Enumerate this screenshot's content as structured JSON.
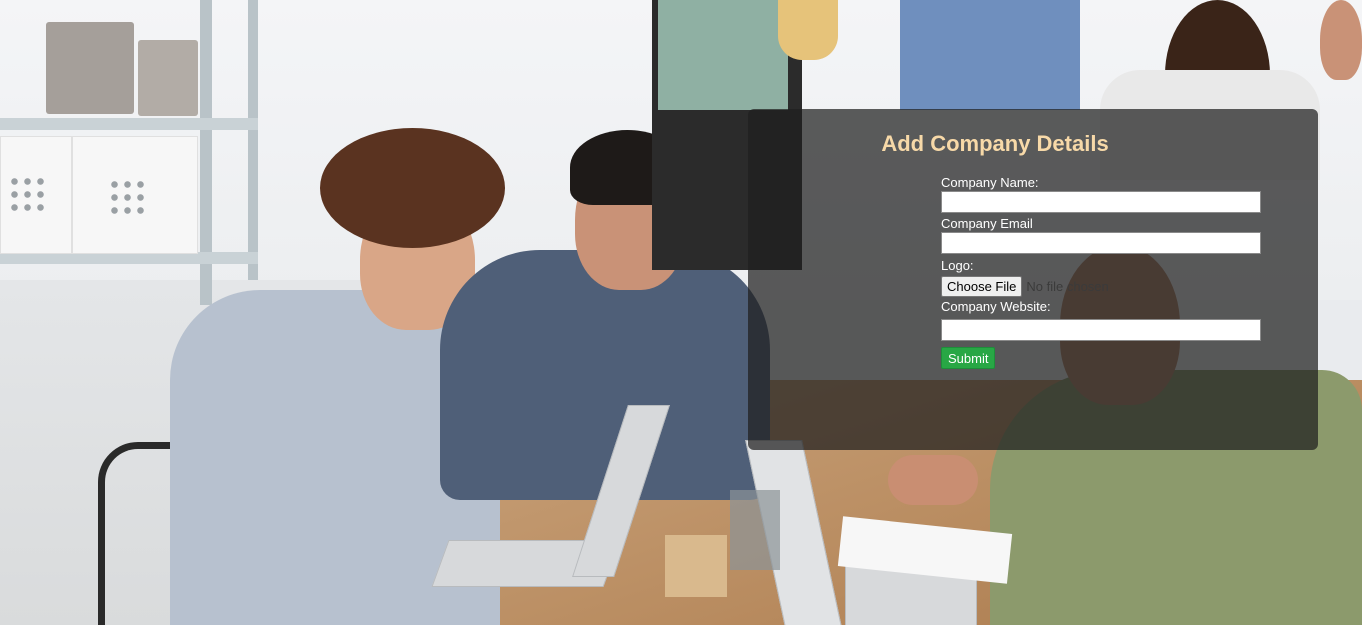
{
  "form": {
    "title": "Add Company Details",
    "fields": {
      "company_name": {
        "label": "Company Name:",
        "value": ""
      },
      "company_email": {
        "label": "Company Email",
        "value": ""
      },
      "logo": {
        "label": "Logo:",
        "button_label": "Choose File",
        "status": "No file chosen"
      },
      "company_website": {
        "label": "Company Website:",
        "value": ""
      }
    },
    "submit_label": "Submit",
    "colors": {
      "title": "#f7d9a8",
      "submit": "#28a745",
      "panel": "rgba(30,30,30,0.72)"
    }
  }
}
